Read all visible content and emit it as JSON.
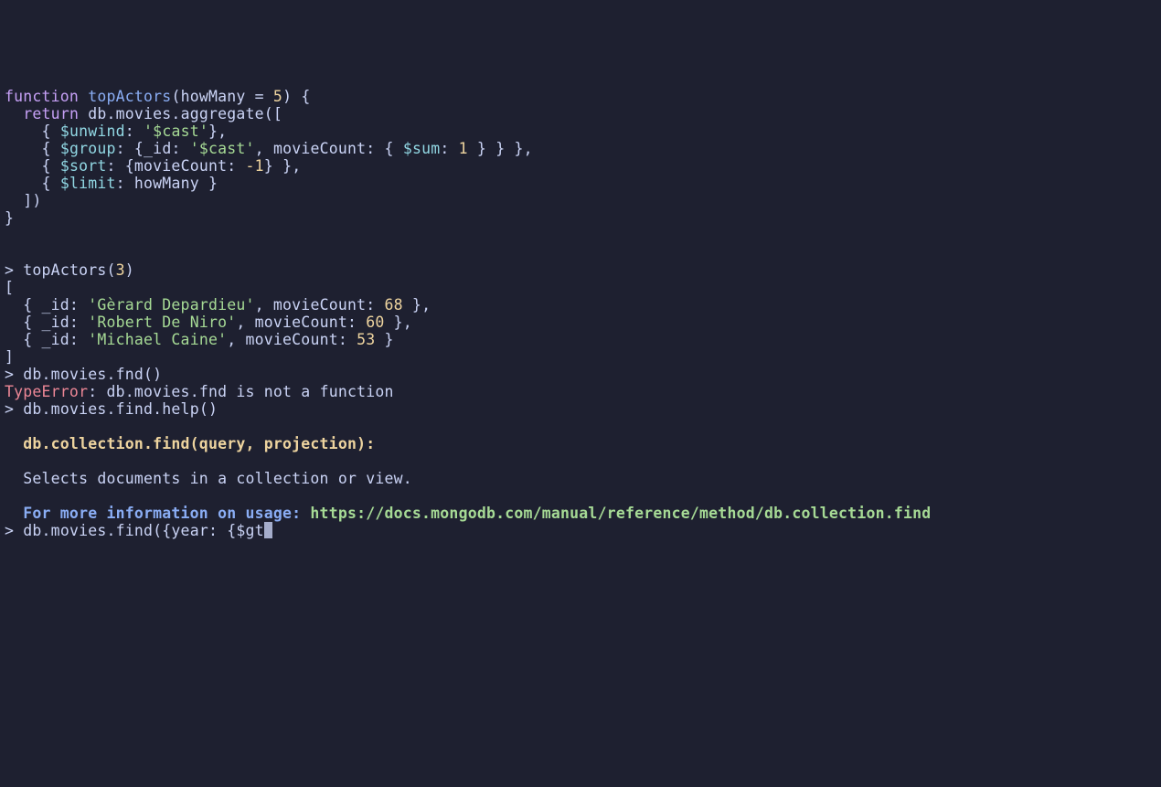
{
  "func": {
    "kw_function": "function",
    "name": "topActors",
    "param": "howMany",
    "eq": " = ",
    "default": "5",
    "open": ") {",
    "kw_return": "return",
    "agg_call": " db.movies.aggregate([",
    "unwind_lbrace": "{ ",
    "unwind_op": "$unwind",
    "unwind_rest": ": ",
    "unwind_str": "'$cast'",
    "unwind_close": "},",
    "group_op": "$group",
    "group_colon": ": {",
    "group_id": "_id",
    "group_idcolon": ": ",
    "group_idstr": "'$cast'",
    "group_mc": ", movieCount: { ",
    "group_sum": "$sum",
    "group_sumcolon": ": ",
    "group_one": "1",
    "group_close": " } } },",
    "sort_op": "$sort",
    "sort_body": ": {movieCount: ",
    "sort_neg1": "-1",
    "sort_close": "} },",
    "limit_op": "$limit",
    "limit_body": ": howMany }",
    "close_arr": "])",
    "close_fn": "}"
  },
  "call": {
    "prompt": "> ",
    "fn": "topActors(",
    "arg": "3",
    "close": ")"
  },
  "results": {
    "open": "[",
    "r1_pre": "  { _id: ",
    "r1_name": "'Gèrard Depardieu'",
    "r1_mid": ", movieCount: ",
    "r1_val": "68",
    "r1_end": " },",
    "r2_pre": "  { _id: ",
    "r2_name": "'Robert De Niro'",
    "r2_mid": ", movieCount: ",
    "r2_val": "60",
    "r2_end": " },",
    "r3_pre": "  { _id: ",
    "r3_name": "'Michael Caine'",
    "r3_mid": ", movieCount: ",
    "r3_val": "53",
    "r3_end": " }",
    "close": "]"
  },
  "errline": {
    "prompt": "> ",
    "cmd": "db.movies.fnd()"
  },
  "error": {
    "label": "TypeError",
    "msg": ": db.movies.fnd is not a function"
  },
  "helpcall": {
    "prompt": "> ",
    "cmd": "db.movies.find.help()"
  },
  "help": {
    "sig": "  db.collection.find(query, projection):",
    "desc": "  Selects documents in a collection or view.",
    "info": "  For more information on usage: ",
    "url": "https://docs.mongodb.com/manual/reference/method/db.collection.find"
  },
  "input": {
    "prompt": "> ",
    "typed": "db.movies.find({year: {$gt"
  }
}
